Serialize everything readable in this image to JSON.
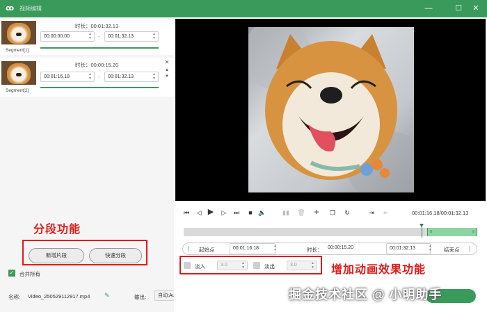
{
  "titlebar": {
    "logo": "ꝏ",
    "app_title": "视频编辑",
    "minimize": "—",
    "maximize": "☐",
    "close": "✕"
  },
  "segments": [
    {
      "label": "Segment[1]",
      "duration": "时长：00:01:32.13",
      "start": "00:00:00.00",
      "end": "00:01:32.13",
      "sep": "-"
    },
    {
      "label": "Segment[2]",
      "duration": "时长：00:00:15.20",
      "start": "00:01:16.18",
      "end": "00:01:32.13",
      "sep": "-",
      "close": "✕",
      "up": "▲",
      "down": "▼"
    }
  ],
  "annotations": {
    "segment_feature": "分段功能",
    "animation_feature": "增加动画效果功能"
  },
  "buttons": {
    "add_segment": "新增片段",
    "quick_split": "快速分段"
  },
  "merge_all": {
    "label": "合并所有",
    "checked": true
  },
  "footer": {
    "name_label": "名称:",
    "file_name": "Video_250529112917.mp4",
    "output_label": "输出:",
    "output_value": "自动;Auto"
  },
  "player": {
    "time_readout": "00:01:16.18/00:01:32.13",
    "progress": 0.83
  },
  "timeline": {
    "selection_start": 0.83,
    "selection_end": 1.0,
    "playhead": 0.81
  },
  "range": {
    "start_button": "起始点",
    "start_value": "00:01:16.18",
    "duration_label": "时长：",
    "duration_value": "00:00:15.20",
    "end_value": "00:01:32.13",
    "end_button": "结束点",
    "left_bracket": "[",
    "right_bracket": "]"
  },
  "fade": {
    "fade_in_label": "淡入",
    "fade_in_value": "3.0",
    "fade_out_label": "淡出",
    "fade_out_value": "3.0"
  },
  "watermark": "掘金技术社区 @ 小明助手",
  "colors": {
    "accent": "#3a9a5c",
    "annotation": "#e01b1b"
  }
}
